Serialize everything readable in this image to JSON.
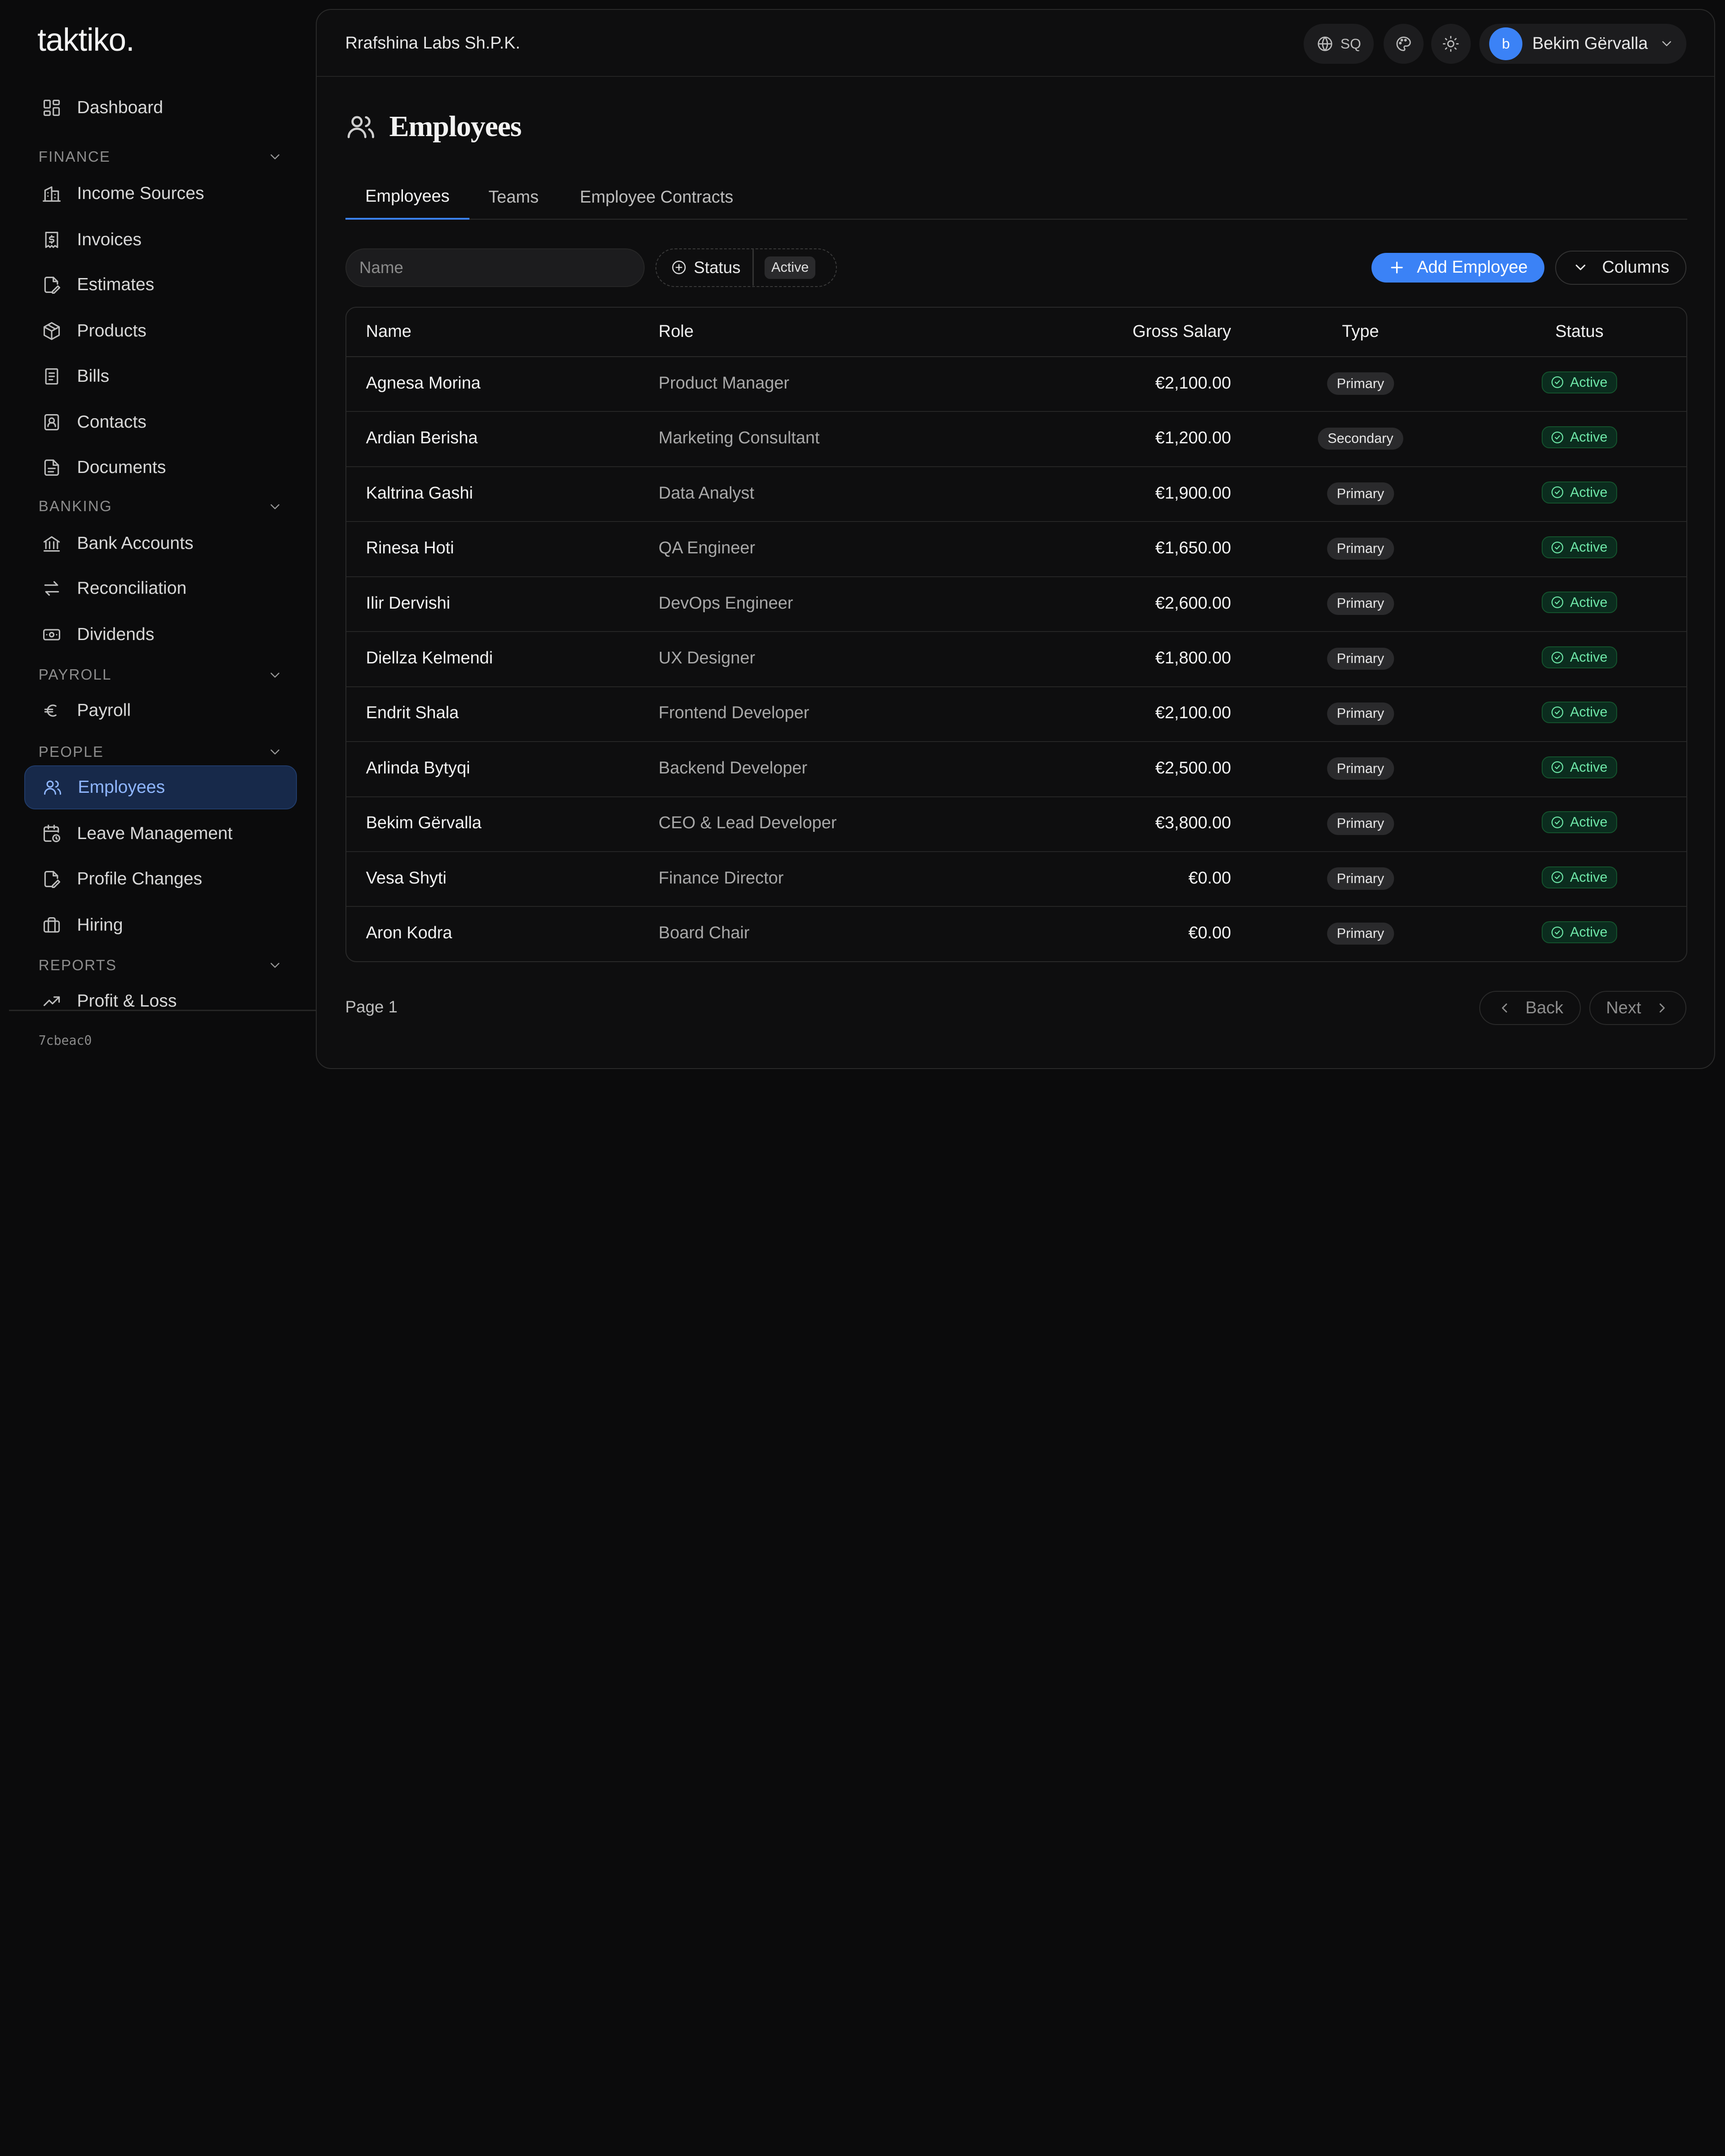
{
  "app": {
    "logo": "taktiko.",
    "version": "7cbeac0"
  },
  "sidebar": {
    "dashboard": "Dashboard",
    "sections": {
      "finance": "FINANCE",
      "banking": "BANKING",
      "payroll": "PAYROLL",
      "people": "PEOPLE",
      "reports": "REPORTS"
    },
    "items": {
      "income_sources": "Income Sources",
      "invoices": "Invoices",
      "estimates": "Estimates",
      "products": "Products",
      "bills": "Bills",
      "contacts": "Contacts",
      "documents": "Documents",
      "bank_accounts": "Bank Accounts",
      "reconciliation": "Reconciliation",
      "dividends": "Dividends",
      "payroll": "Payroll",
      "employees": "Employees",
      "leave_management": "Leave Management",
      "profile_changes": "Profile Changes",
      "hiring": "Hiring",
      "profit_loss": "Profit & Loss"
    },
    "active_item": "Employees"
  },
  "header": {
    "company": "Rrafshina Labs Sh.P.K.",
    "language": "SQ",
    "user": {
      "initial": "b",
      "name": "Bekim Gërvalla"
    }
  },
  "page": {
    "title": "Employees",
    "tabs": [
      "Employees",
      "Teams",
      "Employee Contracts"
    ],
    "active_tab": "Employees"
  },
  "toolbar": {
    "search_placeholder": "Name",
    "status_filter_label": "Status",
    "status_filter_value": "Active",
    "add_label": "Add Employee",
    "columns_label": "Columns"
  },
  "table": {
    "headers": {
      "name": "Name",
      "role": "Role",
      "salary": "Gross Salary",
      "type": "Type",
      "status": "Status"
    },
    "rows": [
      {
        "name": "Agnesa Morina",
        "role": "Product Manager",
        "salary": "€2,100.00",
        "type": "Primary",
        "status": "Active"
      },
      {
        "name": "Ardian Berisha",
        "role": "Marketing Consultant",
        "salary": "€1,200.00",
        "type": "Secondary",
        "status": "Active"
      },
      {
        "name": "Kaltrina Gashi",
        "role": "Data Analyst",
        "salary": "€1,900.00",
        "type": "Primary",
        "status": "Active"
      },
      {
        "name": "Rinesa Hoti",
        "role": "QA Engineer",
        "salary": "€1,650.00",
        "type": "Primary",
        "status": "Active"
      },
      {
        "name": "Ilir Dervishi",
        "role": "DevOps Engineer",
        "salary": "€2,600.00",
        "type": "Primary",
        "status": "Active"
      },
      {
        "name": "Diellza Kelmendi",
        "role": "UX Designer",
        "salary": "€1,800.00",
        "type": "Primary",
        "status": "Active"
      },
      {
        "name": "Endrit Shala",
        "role": "Frontend Developer",
        "salary": "€2,100.00",
        "type": "Primary",
        "status": "Active"
      },
      {
        "name": "Arlinda Bytyqi",
        "role": "Backend Developer",
        "salary": "€2,500.00",
        "type": "Primary",
        "status": "Active"
      },
      {
        "name": "Bekim Gërvalla",
        "role": "CEO & Lead Developer",
        "salary": "€3,800.00",
        "type": "Primary",
        "status": "Active"
      },
      {
        "name": "Vesa Shyti",
        "role": "Finance Director",
        "salary": "€0.00",
        "type": "Primary",
        "status": "Active"
      },
      {
        "name": "Aron Kodra",
        "role": "Board Chair",
        "salary": "€0.00",
        "type": "Primary",
        "status": "Active"
      }
    ]
  },
  "pagination": {
    "page_label": "Page 1",
    "back": "Back",
    "next": "Next"
  },
  "colors": {
    "accent": "#3b82f6",
    "active_nav_bg": "#17294a",
    "status_green": "#6ee7a8",
    "background": "#0b0b0c"
  }
}
